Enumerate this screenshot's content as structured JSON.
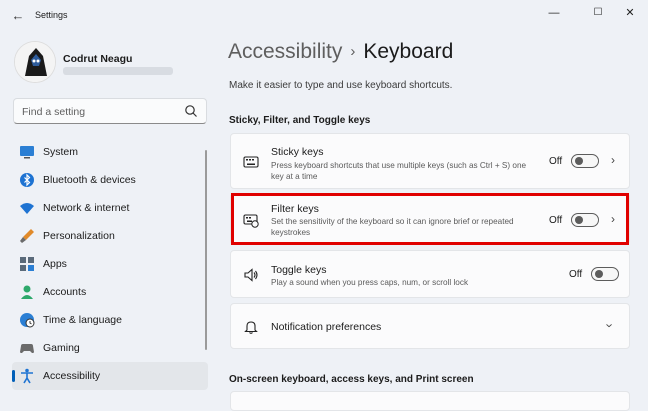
{
  "window": {
    "title": "Settings",
    "minimize": "—",
    "maximize": "☐",
    "close": "✕",
    "back": "←"
  },
  "user": {
    "name": "Codrut Neagu"
  },
  "search": {
    "placeholder": "Find a setting"
  },
  "nav": [
    {
      "label": "System",
      "icon": "monitor-icon"
    },
    {
      "label": "Bluetooth & devices",
      "icon": "bluetooth-icon"
    },
    {
      "label": "Network & internet",
      "icon": "wifi-icon"
    },
    {
      "label": "Personalization",
      "icon": "brush-icon"
    },
    {
      "label": "Apps",
      "icon": "apps-icon"
    },
    {
      "label": "Accounts",
      "icon": "person-icon"
    },
    {
      "label": "Time & language",
      "icon": "globe-clock-icon"
    },
    {
      "label": "Gaming",
      "icon": "gamepad-icon"
    },
    {
      "label": "Accessibility",
      "icon": "accessibility-icon",
      "active": true
    }
  ],
  "breadcrumb": {
    "parent": "Accessibility",
    "separator": "›",
    "current": "Keyboard"
  },
  "description": "Make it easier to type and use keyboard shortcuts.",
  "section1": "Sticky, Filter, and Toggle keys",
  "cards": {
    "sticky": {
      "title": "Sticky keys",
      "sub": "Press keyboard shortcuts that use multiple keys (such as Ctrl + S) one key at a time",
      "state": "Off"
    },
    "filter": {
      "title": "Filter keys",
      "sub": "Set the sensitivity of the keyboard so it can ignore brief or repeated keystrokes",
      "state": "Off"
    },
    "toggle": {
      "title": "Toggle keys",
      "sub": "Play a sound when you press caps, num, or scroll lock",
      "state": "Off"
    },
    "notif": {
      "title": "Notification preferences"
    }
  },
  "section2": "On-screen keyboard, access keys, and Print screen",
  "colors": {
    "accent": "#005fb8",
    "highlight": "#e00000"
  }
}
